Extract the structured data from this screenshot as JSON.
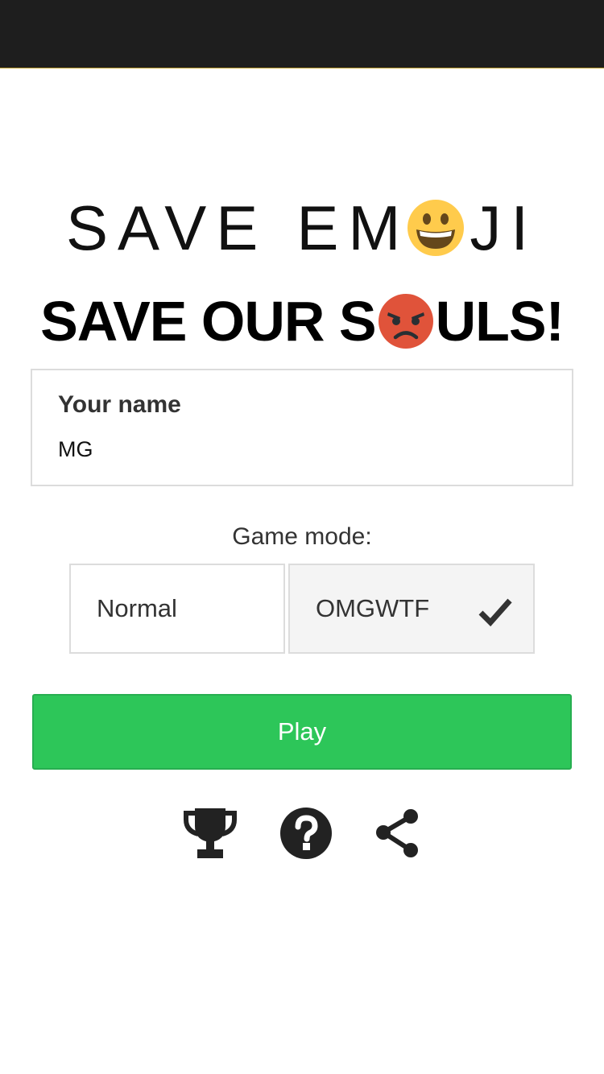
{
  "title": {
    "line1_part1": "SAVE",
    "line1_part2": "EM",
    "line1_part3": "JI",
    "line2_part1": "SAVE OUR S",
    "line2_part2": "ULS!",
    "emoji1": "grinning-face-emoji",
    "emoji2": "angry-face-emoji"
  },
  "name_field": {
    "label": "Your name",
    "value": "MG"
  },
  "game_mode": {
    "label": "Game mode:",
    "options": [
      "Normal",
      "OMGWTF"
    ],
    "selected": "OMGWTF"
  },
  "play_button": {
    "label": "Play",
    "color": "#2dc659"
  },
  "bottom_icons": [
    "trophy-icon",
    "help-icon",
    "share-icon"
  ]
}
